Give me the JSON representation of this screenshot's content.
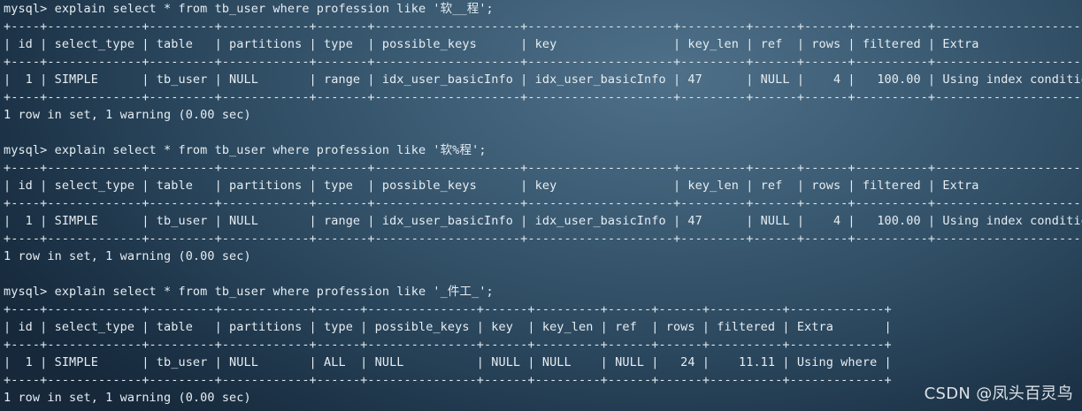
{
  "terminal": {
    "lines": [
      "mysql> explain select * from tb_user where profession like '软__程';",
      "+----+-------------+---------+------------+-------+--------------------+--------------------+---------+------+------+----------+-----------------------+",
      "| id | select_type | table   | partitions | type  | possible_keys      | key                | key_len | ref  | rows | filtered | Extra                 |",
      "+----+-------------+---------+------------+-------+--------------------+--------------------+---------+------+------+----------+-----------------------+",
      "|  1 | SIMPLE      | tb_user | NULL       | range | idx_user_basicInfo | idx_user_basicInfo | 47      | NULL |    4 |   100.00 | Using index condition |",
      "+----+-------------+---------+------------+-------+--------------------+--------------------+---------+------+------+----------+-----------------------+",
      "1 row in set, 1 warning (0.00 sec)",
      "",
      "mysql> explain select * from tb_user where profession like '软%程';",
      "+----+-------------+---------+------------+-------+--------------------+--------------------+---------+------+------+----------+-----------------------+",
      "| id | select_type | table   | partitions | type  | possible_keys      | key                | key_len | ref  | rows | filtered | Extra                 |",
      "+----+-------------+---------+------------+-------+--------------------+--------------------+---------+------+------+----------+-----------------------+",
      "|  1 | SIMPLE      | tb_user | NULL       | range | idx_user_basicInfo | idx_user_basicInfo | 47      | NULL |    4 |   100.00 | Using index condition |",
      "+----+-------------+---------+------------+-------+--------------------+--------------------+---------+------+------+----------+-----------------------+",
      "1 row in set, 1 warning (0.00 sec)",
      "",
      "mysql> explain select * from tb_user where profession like '_件工_';",
      "+----+-------------+---------+------------+------+---------------+------+---------+------+------+----------+-------------+",
      "| id | select_type | table   | partitions | type | possible_keys | key  | key_len | ref  | rows | filtered | Extra       |",
      "+----+-------------+---------+------------+------+---------------+------+---------+------+------+----------+-------------+",
      "|  1 | SIMPLE      | tb_user | NULL       | ALL  | NULL          | NULL | NULL    | NULL |   24 |    11.11 | Using where |",
      "+----+-------------+---------+------------+------+---------------+------+---------+------+------+----------+-------------+",
      "1 row in set, 1 warning (0.00 sec)"
    ]
  },
  "watermark": "CSDN @凤头百灵鸟"
}
